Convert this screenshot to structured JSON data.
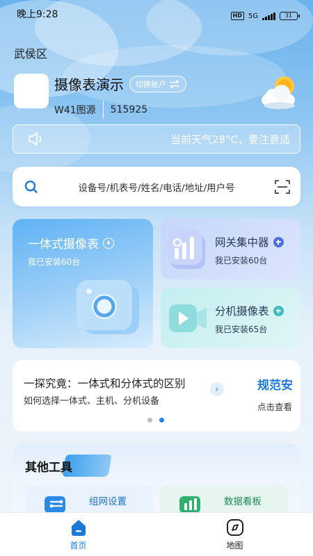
{
  "status_bar": {
    "time": "晚上9:28",
    "network": "5G",
    "battery": "31"
  },
  "location": {
    "district": "武侯区"
  },
  "account": {
    "name": "摄像表演示",
    "switch_label": "切换账户",
    "source": "W41图源",
    "code": "515925"
  },
  "weather": {
    "icon": "partly-cloudy-icon"
  },
  "notice": {
    "text": "当前天气28°C，要注意适",
    "icon": "speaker-icon"
  },
  "search": {
    "placeholder": "设备号/机表号/姓名/电话/地址/用户号",
    "icon": "search-icon",
    "scan_icon": "scan-icon"
  },
  "device_cards": [
    {
      "title": "一体式摄像表",
      "subtitle": "我已安装60台",
      "icon": "camera-icon"
    },
    {
      "title": "网关集中器",
      "subtitle": "我已安装60台",
      "icon": "bar-chart-icon"
    },
    {
      "title": "分机摄像表",
      "subtitle": "我已安装65台",
      "icon": "video-camera-icon"
    }
  ],
  "banner": {
    "title": "一探究竟：一体式和分体式的区别",
    "subtitle": "如何选择一体式、主机、分机设备",
    "side_title": "规范安",
    "side_subtitle": "点击查看",
    "active_page": 2,
    "page_count": 2
  },
  "tools": {
    "title": "其他工具",
    "items": [
      {
        "label": "组网设置",
        "icon": "network-settings-icon"
      },
      {
        "label": "数据看板",
        "icon": "data-dashboard-icon"
      }
    ]
  },
  "tab_bar": [
    {
      "label": "首页",
      "icon": "home-icon",
      "active": true
    },
    {
      "label": "地图",
      "icon": "compass-icon",
      "active": false
    }
  ],
  "colors": {
    "primary": "#1b7ad8",
    "sky_top": "#6ab2ec",
    "card_blue": "#5fb2f5",
    "plus_blue": "#4b6fe0",
    "plus_teal": "#3fbcc2"
  }
}
